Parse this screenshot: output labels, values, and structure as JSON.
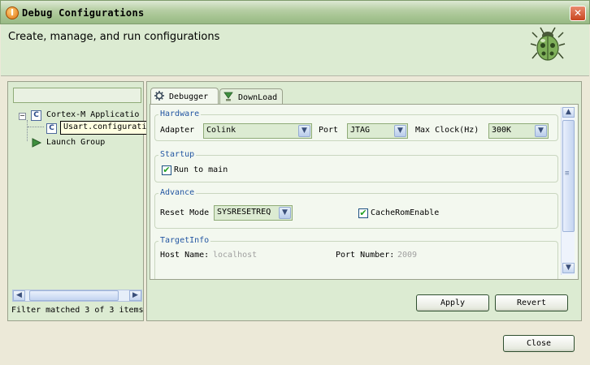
{
  "window": {
    "title": "Debug Configurations",
    "app_icon_letter": "I",
    "close_symbol": "✕"
  },
  "header": {
    "title": "Create, manage, and run configurations",
    "icon": "bug-icon"
  },
  "left": {
    "filter_placeholder": "",
    "tree": [
      {
        "label": "Cortex-M Applicatio",
        "icon": "c-config-icon",
        "expanded": true
      },
      {
        "label": "Usart.configuration",
        "icon": "c-config-icon"
      },
      {
        "label": "Launch Group",
        "icon": "launch-group-icon"
      }
    ],
    "tooltip": "Usart.configuration",
    "filter_status": "Filter matched 3 of 3 items"
  },
  "tabs": [
    {
      "label": "Debugger",
      "icon": "gear-icon",
      "active": true
    },
    {
      "label": "DownLoad",
      "icon": "download-icon",
      "active": false
    }
  ],
  "hardware": {
    "title": "Hardware",
    "adapter_label": "Adapter",
    "adapter_value": "Colink",
    "port_label": "Port",
    "port_value": "JTAG",
    "clock_label": "Max Clock(Hz)",
    "clock_value": "300K"
  },
  "startup": {
    "title": "Startup",
    "run_to_main_label": "Run to main",
    "run_to_main_checked": true
  },
  "advance": {
    "title": "Advance",
    "reset_mode_label": "Reset Mode",
    "reset_mode_value": "SYSRESETREQ",
    "cache_label": "CacheRomEnable",
    "cache_checked": true
  },
  "target": {
    "title": "TargetInfo",
    "host_label": "Host Name:",
    "host_value": "localhost",
    "port_label": "Port Number:",
    "port_value": "2009"
  },
  "buttons": {
    "apply": "Apply",
    "revert": "Revert",
    "close": "Close"
  },
  "glyphs": {
    "arrow_down": "▼",
    "arrow_up": "▲",
    "arrow_left": "◀",
    "arrow_right": "▶",
    "check": "✔",
    "collapse": "−",
    "grip": "≡"
  }
}
